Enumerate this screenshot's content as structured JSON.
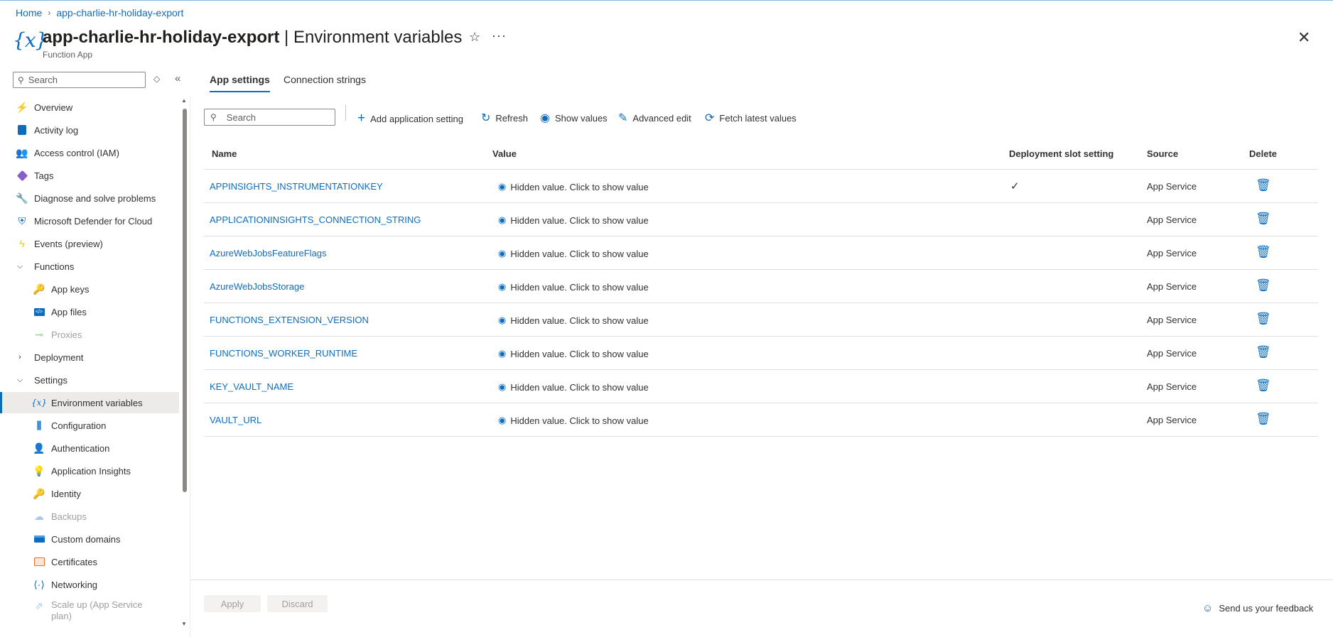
{
  "breadcrumb": {
    "home": "Home",
    "current": "app-charlie-hr-holiday-export"
  },
  "header": {
    "icon_text": "{x}",
    "resource": "app-charlie-hr-holiday-export",
    "separator": " | ",
    "page": "Environment variables",
    "subtitle": "Function App",
    "star": "☆",
    "more": "···",
    "close": "✕"
  },
  "sidebar": {
    "search_placeholder": "Search",
    "items": [
      {
        "label": "Overview",
        "icon": "overview-icon"
      },
      {
        "label": "Activity log",
        "icon": "activity-log-icon"
      },
      {
        "label": "Access control (IAM)",
        "icon": "iam-icon"
      },
      {
        "label": "Tags",
        "icon": "tag-icon"
      },
      {
        "label": "Diagnose and solve problems",
        "icon": "wrench-icon"
      },
      {
        "label": "Microsoft Defender for Cloud",
        "icon": "shield-icon"
      },
      {
        "label": "Events (preview)",
        "icon": "lightning-icon"
      },
      {
        "label": "Functions",
        "icon": "chevron-down-icon"
      },
      {
        "label": "App keys",
        "icon": "key-icon"
      },
      {
        "label": "App files",
        "icon": "code-file-icon"
      },
      {
        "label": "Proxies",
        "icon": "proxy-icon"
      },
      {
        "label": "Deployment",
        "icon": "chevron-right-icon"
      },
      {
        "label": "Settings",
        "icon": "chevron-down-icon"
      },
      {
        "label": "Environment variables",
        "icon": "variable-icon"
      },
      {
        "label": "Configuration",
        "icon": "sliders-icon"
      },
      {
        "label": "Authentication",
        "icon": "person-icon"
      },
      {
        "label": "Application Insights",
        "icon": "bulb-icon"
      },
      {
        "label": "Identity",
        "icon": "identity-icon"
      },
      {
        "label": "Backups",
        "icon": "cloud-icon"
      },
      {
        "label": "Custom domains",
        "icon": "domain-icon"
      },
      {
        "label": "Certificates",
        "icon": "certificate-icon"
      },
      {
        "label": "Networking",
        "icon": "network-icon"
      },
      {
        "label": "Scale up (App Service plan)",
        "icon": "scale-up-icon"
      }
    ]
  },
  "tabs": [
    {
      "label": "App settings",
      "active": true
    },
    {
      "label": "Connection strings",
      "active": false
    }
  ],
  "toolbar": {
    "search_placeholder": "Search",
    "add": "Add application setting",
    "refresh": "Refresh",
    "show_values": "Show values",
    "advanced_edit": "Advanced edit",
    "fetch": "Fetch latest values"
  },
  "table": {
    "columns": [
      "Name",
      "Value",
      "Deployment slot setting",
      "Source",
      "Delete"
    ],
    "rows": [
      {
        "name": "APPINSIGHTS_INSTRUMENTATIONKEY",
        "value": "Hidden value. Click to show value",
        "slot": "✓",
        "source": "App Service"
      },
      {
        "name": "APPLICATIONINSIGHTS_CONNECTION_STRING",
        "value": "Hidden value. Click to show value",
        "slot": "",
        "source": "App Service"
      },
      {
        "name": "AzureWebJobsFeatureFlags",
        "value": "Hidden value. Click to show value",
        "slot": "",
        "source": "App Service"
      },
      {
        "name": "AzureWebJobsStorage",
        "value": "Hidden value. Click to show value",
        "slot": "",
        "source": "App Service"
      },
      {
        "name": "FUNCTIONS_EXTENSION_VERSION",
        "value": "Hidden value. Click to show value",
        "slot": "",
        "source": "App Service"
      },
      {
        "name": "FUNCTIONS_WORKER_RUNTIME",
        "value": "Hidden value. Click to show value",
        "slot": "",
        "source": "App Service"
      },
      {
        "name": "KEY_VAULT_NAME",
        "value": "Hidden value. Click to show value",
        "slot": "",
        "source": "App Service"
      },
      {
        "name": "VAULT_URL",
        "value": "Hidden value. Click to show value",
        "slot": "",
        "source": "App Service"
      }
    ]
  },
  "footer": {
    "apply": "Apply",
    "discard": "Discard",
    "feedback": "Send us your feedback"
  },
  "colors": {
    "accent": "#0f6cbd",
    "selected_bg": "#edebe9",
    "disabled_text": "#a19f9d"
  }
}
